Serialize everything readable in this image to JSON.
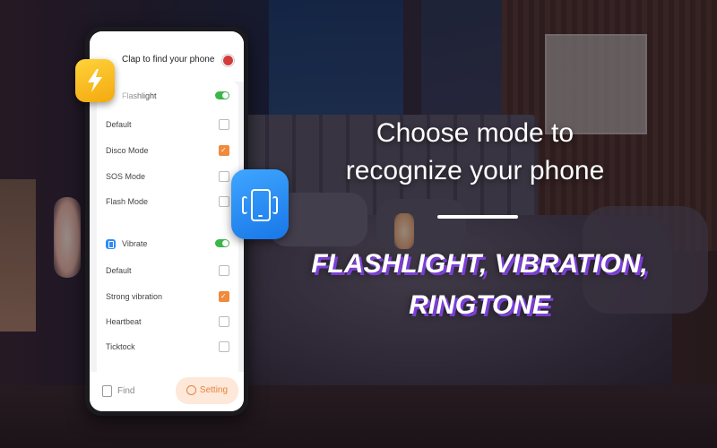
{
  "app": {
    "title": "Clap to find your phone"
  },
  "flashlight_section": {
    "header_label": "Flashlight",
    "enabled": true,
    "options": [
      {
        "label": "Default",
        "checked": false
      },
      {
        "label": "Disco Mode",
        "checked": true
      },
      {
        "label": "SOS Mode",
        "checked": false
      },
      {
        "label": "Flash Mode",
        "checked": false
      }
    ]
  },
  "vibrate_section": {
    "header_label": "Vibrate",
    "enabled": true,
    "options": [
      {
        "label": "Default",
        "checked": false
      },
      {
        "label": "Strong vibration",
        "checked": true
      },
      {
        "label": "Heartbeat",
        "checked": false
      },
      {
        "label": "Ticktock",
        "checked": false
      }
    ]
  },
  "bottom_nav": {
    "find_label": "Find",
    "setting_label": "Setting",
    "active": "setting"
  },
  "promo": {
    "headline_line1": "Choose mode to",
    "headline_line2": "recognize your phone",
    "features_line1": "FLASHLIGHT, VIBRATION,",
    "features_line2": "RINGTONE"
  },
  "colors": {
    "accent_orange": "#f08a3c",
    "toggle_green": "#3bb64a",
    "flash_yellow": "#f7b91a",
    "vibrate_blue": "#2f8cf5",
    "feature_shadow_purple": "#7b3fd6"
  },
  "icons": [
    "flashlight-icon",
    "vibrate-phone-icon",
    "flag-icon",
    "find-icon",
    "setting-gear-icon"
  ]
}
